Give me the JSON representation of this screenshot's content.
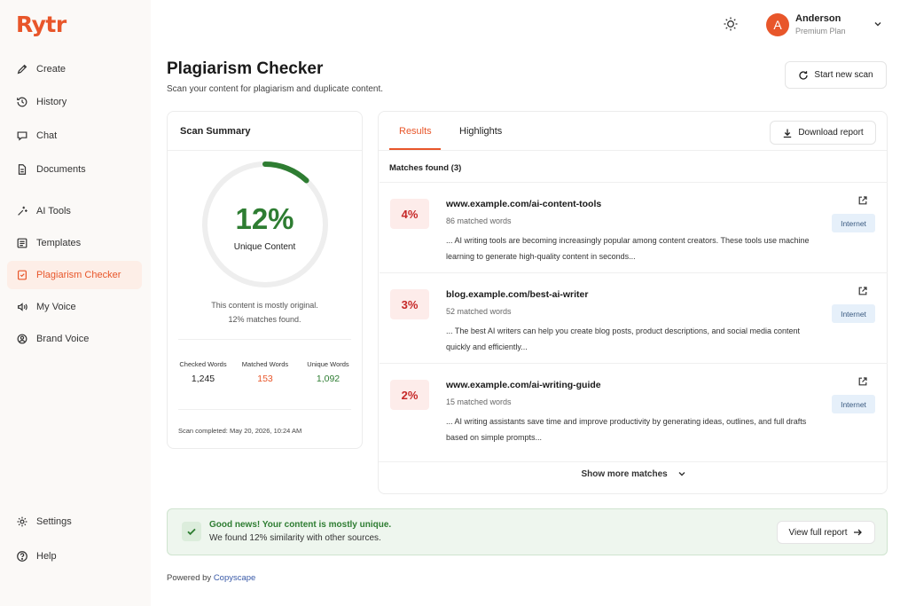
{
  "app": {
    "logo": "Rytr"
  },
  "sidebar": {
    "items": [
      {
        "label": "Create",
        "icon": "pencil-icon"
      },
      {
        "label": "History",
        "icon": "history-icon"
      },
      {
        "label": "Chat",
        "icon": "chat-icon"
      },
      {
        "label": "Documents",
        "icon": "document-icon"
      },
      {
        "label": "AI Tools",
        "icon": "sparkle-icon"
      },
      {
        "label": "Templates",
        "icon": "template-icon"
      },
      {
        "label": "Plagiarism Checker",
        "icon": "plagiarism-icon",
        "active": true
      },
      {
        "label": "My Voice",
        "icon": "voice-icon"
      },
      {
        "label": "Brand Voice",
        "icon": "brand-icon"
      }
    ],
    "settings_label": "Settings",
    "help_label": "Help"
  },
  "header": {
    "theme_icon": "sun-icon",
    "user_initial": "A",
    "user_name": "Anderson",
    "user_plan": "Premium Plan"
  },
  "page": {
    "title": "Plagiarism Checker",
    "subtitle": "Scan your content for plagiarism and duplicate content.",
    "start_scan_label": "Start new scan"
  },
  "summary": {
    "title": "Scan Summary",
    "unique_percent_text": "12%",
    "ring_fraction": 0.12,
    "unique_label": "Unique Content",
    "note_line1": "This content is mostly original.",
    "note_line2": "12% matches found.",
    "stats": [
      {
        "label": "Checked Words",
        "value": "1,245",
        "color": "#222222"
      },
      {
        "label": "Matched Words",
        "value": "153",
        "color": "#e8562a"
      },
      {
        "label": "Unique Words",
        "value": "1,092",
        "color": "#2e7d32"
      }
    ],
    "scan_completed": "Scan completed: May 20, 2026, 10:24 AM"
  },
  "results": {
    "tabs": [
      "Results",
      "Highlights"
    ],
    "download_label": "Download report",
    "matches_found": "Matches found (3)",
    "matches": [
      {
        "percent": "4%",
        "url": "www.example.com/ai-content-tools",
        "matched_words": "86 matched words",
        "snippet": "... AI writing tools are becoming increasingly popular among content creators. These tools use machine learning to generate high-quality content in seconds...",
        "badge": "Internet"
      },
      {
        "percent": "3%",
        "url": "blog.example.com/best-ai-writer",
        "matched_words": "52 matched words",
        "snippet": "... The best AI writers can help you create blog posts, product descriptions, and social media content quickly and efficiently...",
        "badge": "Internet"
      },
      {
        "percent": "2%",
        "url": "www.example.com/ai-writing-guide",
        "matched_words": "15 matched words",
        "snippet": "... AI writing assistants save time and improve productivity by generating ideas, outlines, and full drafts based on simple prompts...",
        "badge": "Internet"
      }
    ],
    "show_more_label": "Show more matches"
  },
  "banner": {
    "title": "Good news! Your content is mostly unique.",
    "subtitle": "We found 12% similarity with other sources.",
    "button_label": "View full report"
  },
  "footer": {
    "powered_prefix": "Powered by",
    "powered_link": "Copyscape"
  },
  "colors": {
    "accent": "#e8562a",
    "success": "#2e7d32",
    "danger_bg": "#fdecea"
  }
}
